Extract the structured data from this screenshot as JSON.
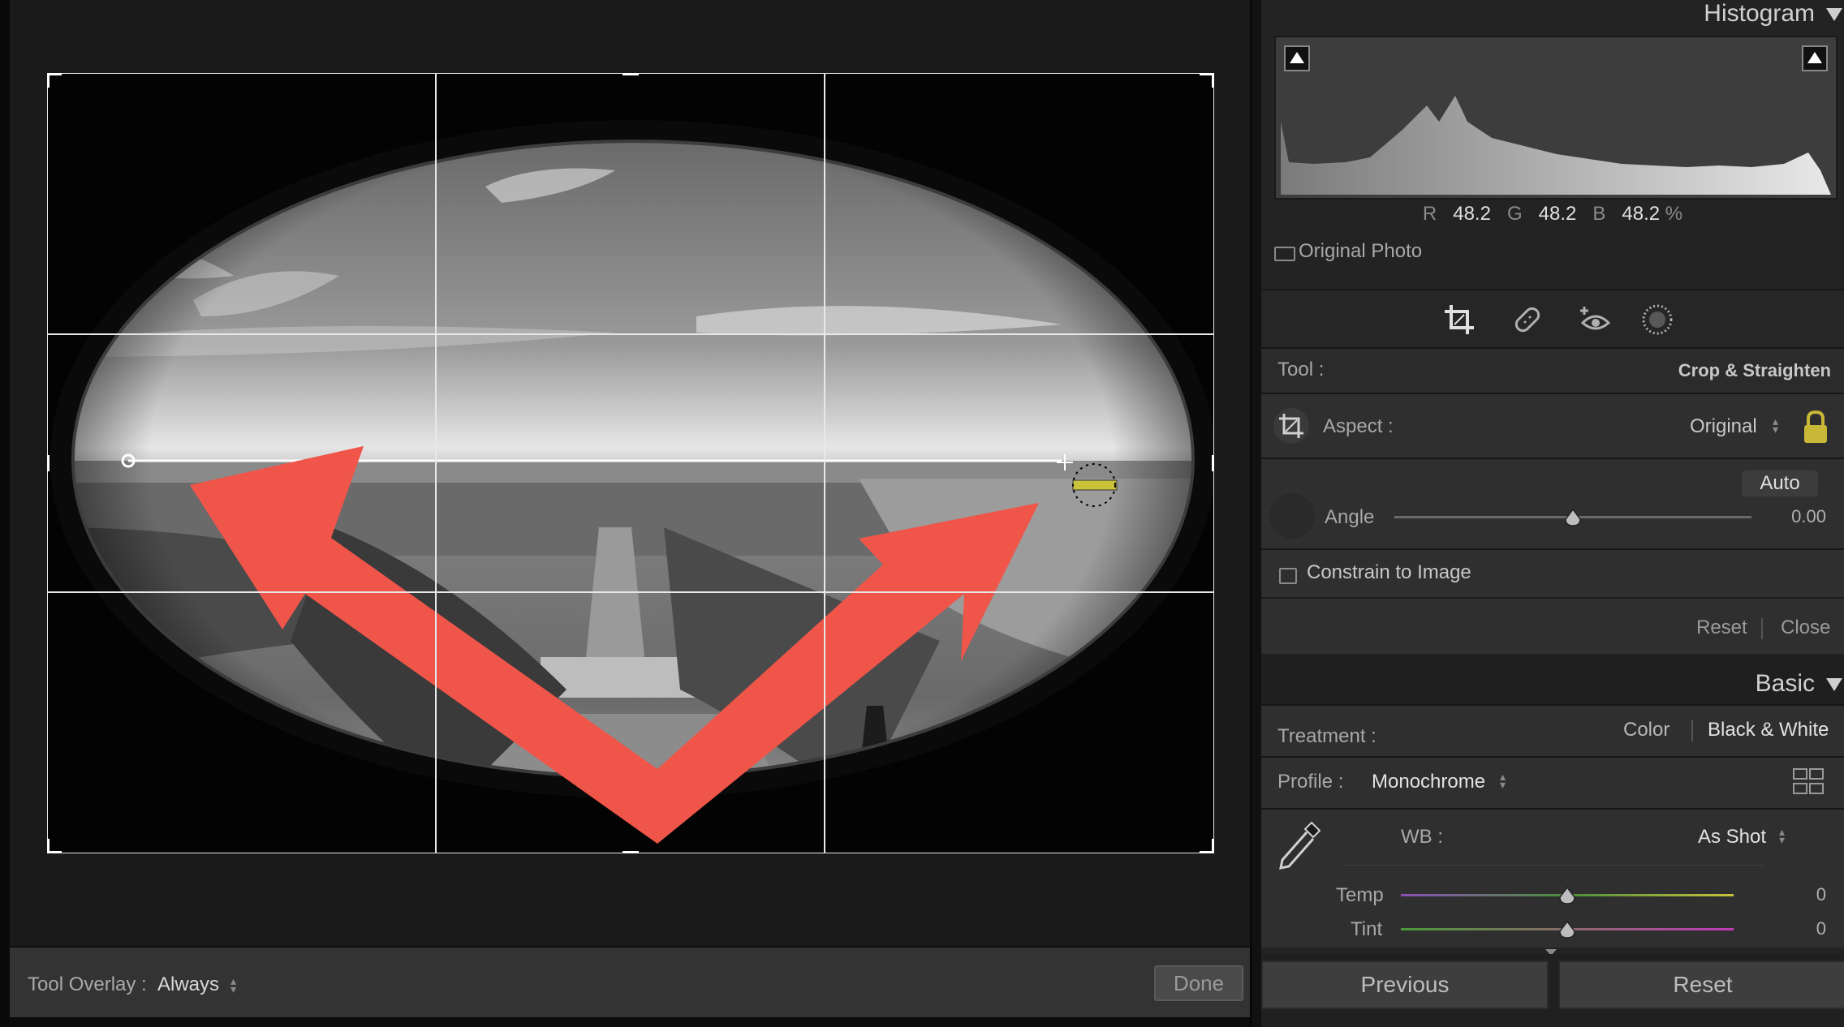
{
  "canvas": {
    "photo_alt": "monochrome fisheye aerial view of the National Mall with red arrow overlay"
  },
  "toolbar": {
    "overlay_label": "Tool Overlay :",
    "overlay_value": "Always",
    "done_label": "Done"
  },
  "histogram": {
    "title": "Histogram",
    "r_label": "R",
    "r_value": "48.2",
    "g_label": "G",
    "g_value": "48.2",
    "b_label": "B",
    "b_value": "48.2",
    "percent": "%",
    "original_photo_label": "Original Photo"
  },
  "tools": {
    "icons": [
      "crop-icon",
      "healing-icon",
      "redeye-icon",
      "mask-icon"
    ]
  },
  "crop": {
    "tool_label": "Tool :",
    "tool_value": "Crop & Straighten",
    "aspect_label": "Aspect :",
    "aspect_value": "Original",
    "auto_label": "Auto",
    "angle_label": "Angle",
    "angle_value": "0.00",
    "angle_level": 0.5,
    "constrain_label": "Constrain to Image",
    "reset_label": "Reset",
    "close_label": "Close"
  },
  "basic": {
    "title": "Basic",
    "treatment_label": "Treatment :",
    "treatment_color": "Color",
    "treatment_bw": "Black & White",
    "profile_label": "Profile :",
    "profile_value": "Monochrome",
    "wb_label": "WB :",
    "wb_value": "As Shot",
    "temp_label": "Temp",
    "temp_value": "0",
    "temp_level": 0.5,
    "tint_label": "Tint",
    "tint_value": "0",
    "tint_level": 0.5
  },
  "footer": {
    "previous_label": "Previous",
    "reset_label": "Reset"
  },
  "colors": {
    "arrow": "#f0554a",
    "lock": "#c9b838",
    "level_badge": "#c9c23a"
  }
}
